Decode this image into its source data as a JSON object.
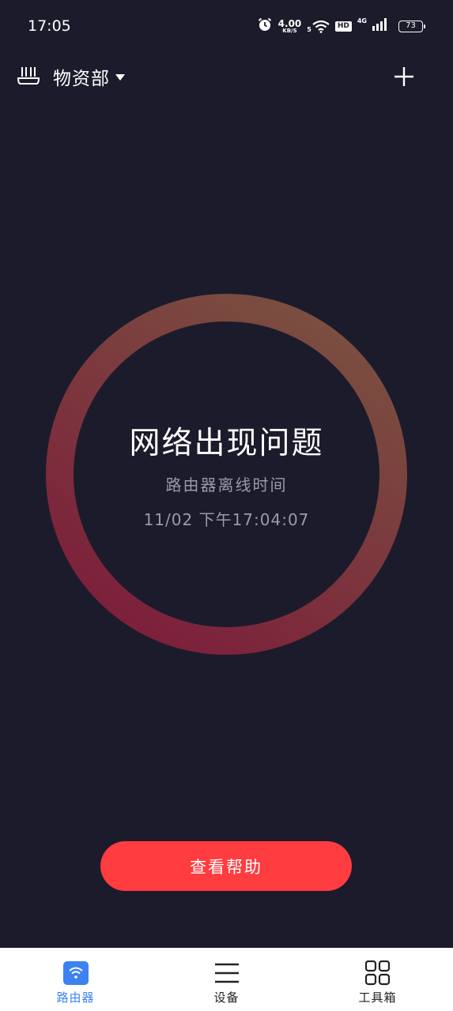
{
  "status_bar": {
    "time": "17:05",
    "speed_value": "4.00",
    "speed_unit": "KB/S",
    "wifi_band": "5",
    "hd": "HD",
    "network": "4G",
    "battery": "73"
  },
  "header": {
    "location": "物资部",
    "icons": {
      "router": "router-icon",
      "dropdown": "caret-down-icon",
      "add": "plus-icon"
    }
  },
  "status": {
    "title": "网络出现问题",
    "subtitle": "路由器离线时间",
    "offline_time": "11/02  下午17:04:07",
    "ring_colors": [
      "#7a5140",
      "#7d1e3b"
    ]
  },
  "help_button": {
    "label": "查看帮助",
    "color": "#ff3c3f"
  },
  "tabs": [
    {
      "label": "路由器",
      "icon": "wifi-icon",
      "active": true
    },
    {
      "label": "设备",
      "icon": "menu-icon",
      "active": false
    },
    {
      "label": "工具箱",
      "icon": "grid-icon",
      "active": false
    }
  ],
  "colors": {
    "background": "#1c1b2b",
    "accent": "#3d82f0"
  }
}
